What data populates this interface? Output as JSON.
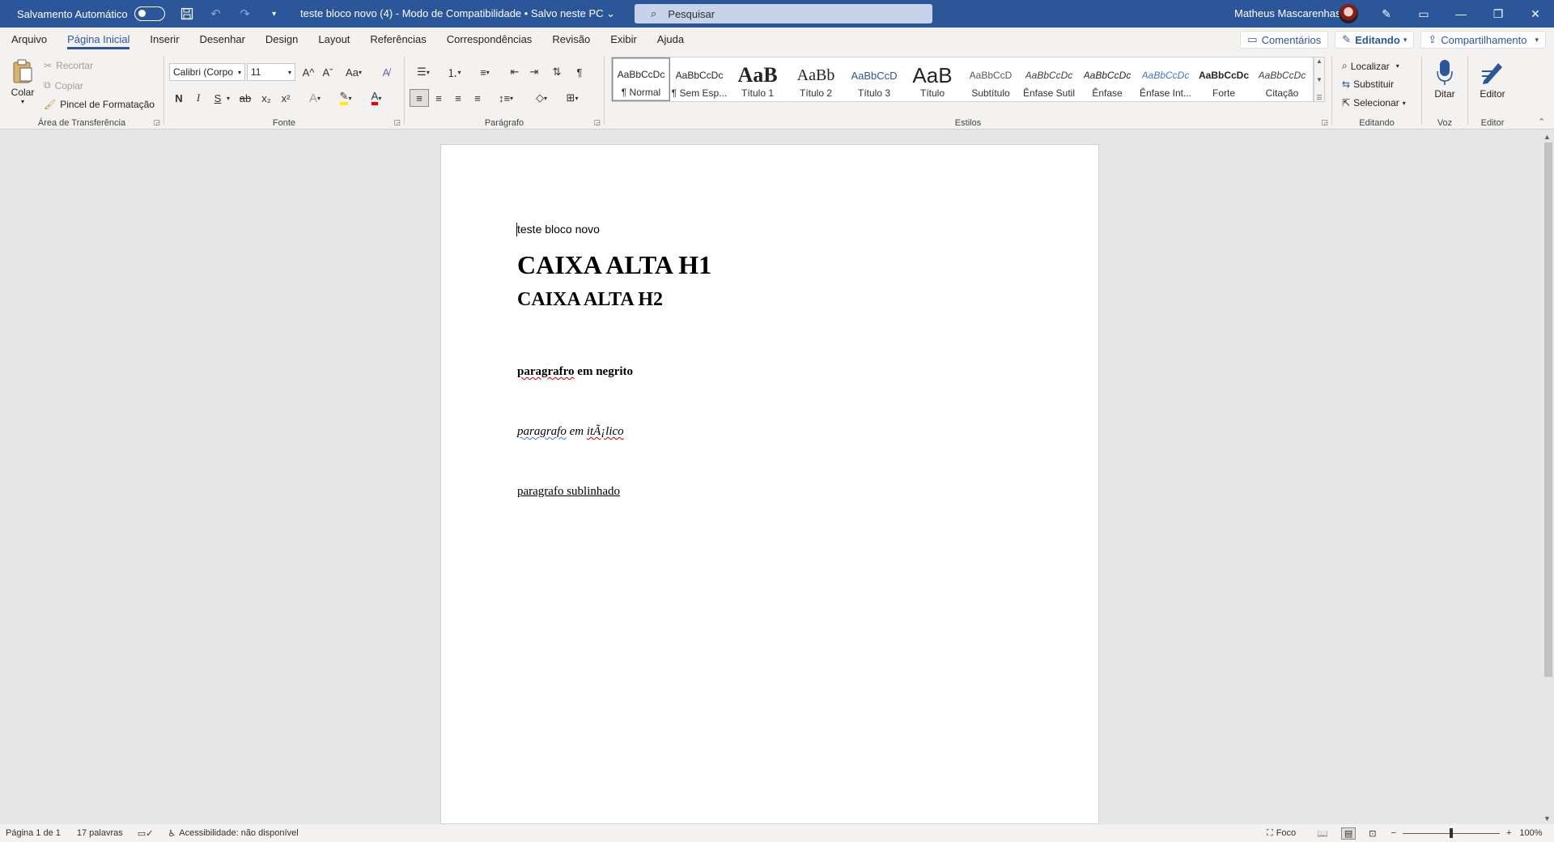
{
  "titlebar": {
    "autosave_label": "Salvamento Automático",
    "doc_title": "teste bloco novo (4)  -  Modo de Compatibilidade • Salvo neste PC",
    "search_placeholder": "Pesquisar",
    "user_name": "Matheus Mascarenhas",
    "icons": [
      "save-icon",
      "undo-icon",
      "redo-icon",
      "customize-icon",
      "pen-icon",
      "ribbon-display-icon",
      "minimize-icon",
      "restore-icon",
      "close-icon"
    ]
  },
  "tabs": [
    "Arquivo",
    "Página Inicial",
    "Inserir",
    "Desenhar",
    "Design",
    "Layout",
    "Referências",
    "Correspondências",
    "Revisão",
    "Exibir",
    "Ajuda"
  ],
  "active_tab": "Página Inicial",
  "ribbon_right": {
    "comments": "Comentários",
    "editing": "Editando",
    "share": "Compartilhamento"
  },
  "clipboard": {
    "paste": "Colar",
    "cut": "Recortar",
    "copy": "Copiar",
    "format_painter": "Pincel de Formatação",
    "label": "Área de Transferência"
  },
  "font": {
    "family": "Calibri (Corpo",
    "size": "11",
    "label": "Fonte",
    "bold": "N",
    "italic": "I",
    "underline": "S",
    "strike": "ab",
    "subscript": "x₂",
    "superscript": "x²",
    "grow": "A^",
    "shrink": "Aˇ",
    "case": "Aa",
    "effects": "A",
    "highlight": "ab",
    "color": "A"
  },
  "paragraph": {
    "label": "Parágrafo"
  },
  "styles": {
    "label": "Estilos",
    "items": [
      {
        "preview": "AaBbCcDc",
        "name": "¶ Normal"
      },
      {
        "preview": "AaBbCcDc",
        "name": "¶ Sem Esp..."
      },
      {
        "preview": "AaB",
        "name": "Título 1"
      },
      {
        "preview": "AaBb",
        "name": "Título 2"
      },
      {
        "preview": "AaBbCcD",
        "name": "Título 3"
      },
      {
        "preview": "AaB",
        "name": "Título"
      },
      {
        "preview": "AaBbCcD",
        "name": "Subtítulo"
      },
      {
        "preview": "AaBbCcDc",
        "name": "Ênfase Sutil"
      },
      {
        "preview": "AaBbCcDc",
        "name": "Ênfase"
      },
      {
        "preview": "AaBbCcDc",
        "name": "Ênfase Int..."
      },
      {
        "preview": "AaBbCcDc",
        "name": "Forte"
      },
      {
        "preview": "AaBbCcDc",
        "name": "Citação"
      }
    ]
  },
  "editing": {
    "find": "Localizar",
    "replace": "Substituir",
    "select": "Selecionar",
    "label": "Editando"
  },
  "voice": {
    "dictate": "Ditar",
    "label": "Voz"
  },
  "editor": {
    "button": "Editor",
    "label": "Editor"
  },
  "document": {
    "line1": "teste bloco novo",
    "h1": "CAIXA ALTA H1",
    "h2": "CAIXA ALTA H2",
    "bold_word1": "paragrafro",
    "bold_rest": " em negrito",
    "italic_word1": "paragrafo",
    "italic_mid": " em ",
    "italic_word2": "itÃ¡lico",
    "underline_text": "paragrafo sublinhado"
  },
  "statusbar": {
    "page": "Página 1 de 1",
    "words": "17 palavras",
    "accessibility": "Acessibilidade: não disponível",
    "focus": "Foco",
    "zoom": "100%",
    "zoom_level": 1.0
  }
}
